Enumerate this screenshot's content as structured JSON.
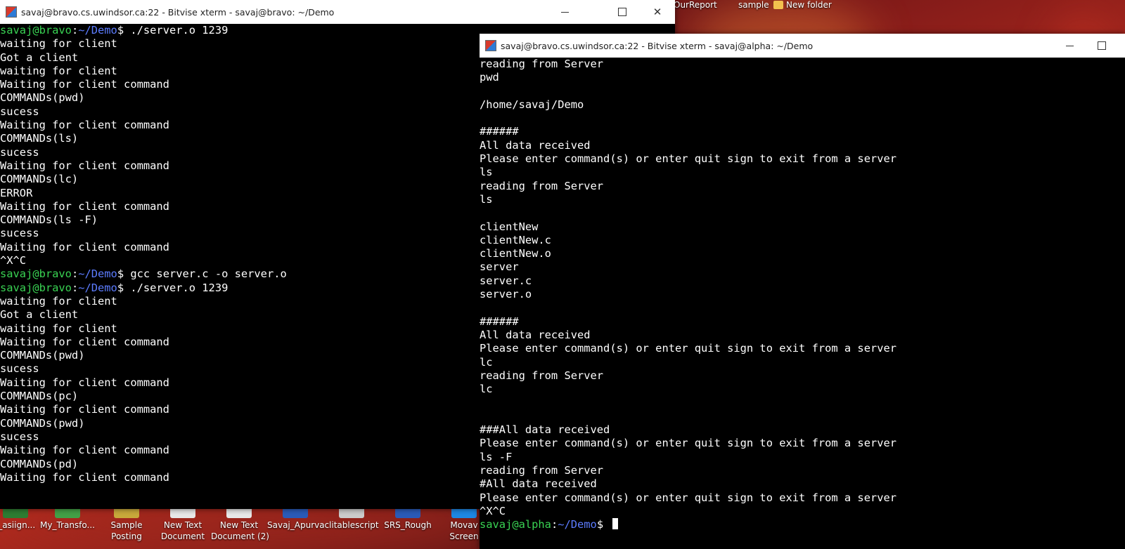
{
  "desktop": {
    "top_icons": [
      "OurReport",
      "sample",
      "New folder"
    ],
    "bottom_icons": [
      {
        "label": "j_asiign...",
        "color": "#2e7d32"
      },
      {
        "label": "My_Transfo...",
        "color": "#43a047"
      },
      {
        "label": "Sample\nPosting",
        "color": "#c9a93b"
      },
      {
        "label": "New Text\nDocument",
        "color": "#e8e8e8"
      },
      {
        "label": "New Text\nDocument (2)",
        "color": "#e8e8e8"
      },
      {
        "label": "Savaj_Apurva",
        "color": "#2b5bb8"
      },
      {
        "label": "clitablescript",
        "color": "#cccccc"
      },
      {
        "label": "SRS_Rough",
        "color": "#2b5bb8"
      },
      {
        "label": "Movav\nScreen",
        "color": "#1e88e5"
      }
    ]
  },
  "window_left": {
    "title": "savaj@bravo.cs.uwindsor.ca:22 - Bitvise xterm - savaj@bravo: ~/Demo",
    "lines": [
      {
        "user": "savaj@bravo",
        "path": "~/Demo",
        "cmd": "$ ./server.o 1239"
      },
      {
        "text": "waiting for client"
      },
      {
        "text": "Got a client"
      },
      {
        "text": "waiting for client"
      },
      {
        "text": "Waiting for client command"
      },
      {
        "text": "COMMANDs(pwd)"
      },
      {
        "text": "sucess"
      },
      {
        "text": "Waiting for client command"
      },
      {
        "text": "COMMANDs(ls)"
      },
      {
        "text": "sucess"
      },
      {
        "text": "Waiting for client command"
      },
      {
        "text": "COMMANDs(lc)"
      },
      {
        "text": "ERROR"
      },
      {
        "text": "Waiting for client command"
      },
      {
        "text": "COMMANDs(ls -F)"
      },
      {
        "text": "sucess"
      },
      {
        "text": "Waiting for client command"
      },
      {
        "text": "^X^C"
      },
      {
        "user": "savaj@bravo",
        "path": "~/Demo",
        "cmd": "$ gcc server.c -o server.o"
      },
      {
        "user": "savaj@bravo",
        "path": "~/Demo",
        "cmd": "$ ./server.o 1239"
      },
      {
        "text": "waiting for client"
      },
      {
        "text": "Got a client"
      },
      {
        "text": "waiting for client"
      },
      {
        "text": "Waiting for client command"
      },
      {
        "text": "COMMANDs(pwd)"
      },
      {
        "text": "sucess"
      },
      {
        "text": "Waiting for client command"
      },
      {
        "text": "COMMANDs(pc)"
      },
      {
        "text": "Waiting for client command"
      },
      {
        "text": "COMMANDs(pwd)"
      },
      {
        "text": "sucess"
      },
      {
        "text": "Waiting for client command"
      },
      {
        "text": "COMMANDs(pd)"
      },
      {
        "text": "Waiting for client command"
      }
    ]
  },
  "window_right": {
    "title": "savaj@bravo.cs.uwindsor.ca:22 - Bitvise xterm - savaj@alpha: ~/Demo",
    "lines": [
      {
        "text": "reading from Server"
      },
      {
        "text": "pwd"
      },
      {
        "text": ""
      },
      {
        "text": "/home/savaj/Demo"
      },
      {
        "text": ""
      },
      {
        "text": "######"
      },
      {
        "text": "All data received"
      },
      {
        "text": "Please enter command(s) or enter quit sign to exit from a server"
      },
      {
        "text": "ls"
      },
      {
        "text": "reading from Server"
      },
      {
        "text": "ls"
      },
      {
        "text": ""
      },
      {
        "text": "clientNew"
      },
      {
        "text": "clientNew.c"
      },
      {
        "text": "clientNew.o"
      },
      {
        "text": "server"
      },
      {
        "text": "server.c"
      },
      {
        "text": "server.o"
      },
      {
        "text": ""
      },
      {
        "text": "######"
      },
      {
        "text": "All data received"
      },
      {
        "text": "Please enter command(s) or enter quit sign to exit from a server"
      },
      {
        "text": "lc"
      },
      {
        "text": "reading from Server"
      },
      {
        "text": "lc"
      },
      {
        "text": ""
      },
      {
        "text": ""
      },
      {
        "text": "###All data received"
      },
      {
        "text": "Please enter command(s) or enter quit sign to exit from a server"
      },
      {
        "text": "ls -F"
      },
      {
        "text": "reading from Server"
      },
      {
        "text": "#All data received"
      },
      {
        "text": "Please enter command(s) or enter quit sign to exit from a server"
      },
      {
        "text": "^X^C"
      },
      {
        "user": "savaj@alpha",
        "path": "~/Demo",
        "cmd": "$ ",
        "cursor": true
      }
    ]
  }
}
